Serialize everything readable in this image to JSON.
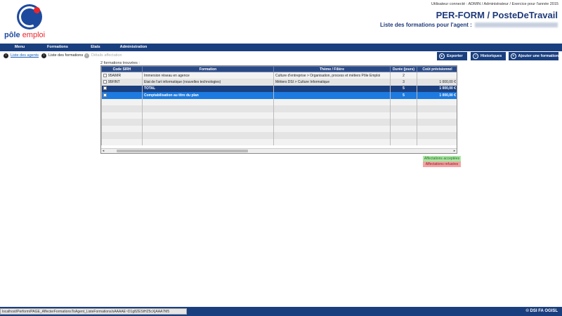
{
  "header": {
    "logo_text_a": "pôle",
    "logo_text_b": "emploi",
    "user_line": "Utilisateur connecté : ADMIN / Administrateur / Exercice pour l'année 2015",
    "app_title": "PER-FORM / PosteDeTravail",
    "sub_title": "Liste des formations pour l'agent :"
  },
  "nav": [
    "Menu",
    "Formations",
    "Etats",
    "Administration"
  ],
  "breadcrumb": [
    {
      "label": "Liste des agents",
      "state": "link"
    },
    {
      "label": "Liste des formations",
      "state": "current"
    },
    {
      "label": "Détails affectation",
      "state": "disabled"
    }
  ],
  "actions": {
    "exporter": "Exporter",
    "historiques": "Historiques",
    "ajouter": "Ajouter une formation"
  },
  "count_text": "2 formations trouvées :",
  "grid": {
    "columns": [
      "Code SIRH",
      "Formation",
      "Thème / Filière",
      "Durée (jours)",
      "Coût prévisionnel"
    ],
    "rows": [
      {
        "code": "95AIMR",
        "formation": "Immersion réseau en agence",
        "theme": "Culture d'entreprise > Organisation, process et métiers Pôle Emploi",
        "duree": "2",
        "cout": ""
      },
      {
        "code": "95FINT",
        "formation": "Etat de l'art informatique (nouvelles technologies)",
        "theme": "Métiers DSI > Culture Informatique",
        "duree": "3",
        "cout": "1 000,00 €"
      },
      {
        "code": "",
        "formation": "TOTAL",
        "theme": "",
        "duree": "5",
        "cout": "1 000,00 €"
      },
      {
        "code": "",
        "formation": "Comptabilisation au titre du plan",
        "theme": "",
        "duree": "5",
        "cout": "1 000,00 €"
      }
    ]
  },
  "legend": {
    "accepted": "Affectations acceptées",
    "refused": "Affectations refusées"
  },
  "footer": {
    "status_url": "localhost/Perform/PAGE_AffecterFormationsToAgent_ListeFormations/sAAAAE~D1g8ZEStHZ5cXjAAA7M5",
    "copyright": "© DSI FA OGISL"
  }
}
